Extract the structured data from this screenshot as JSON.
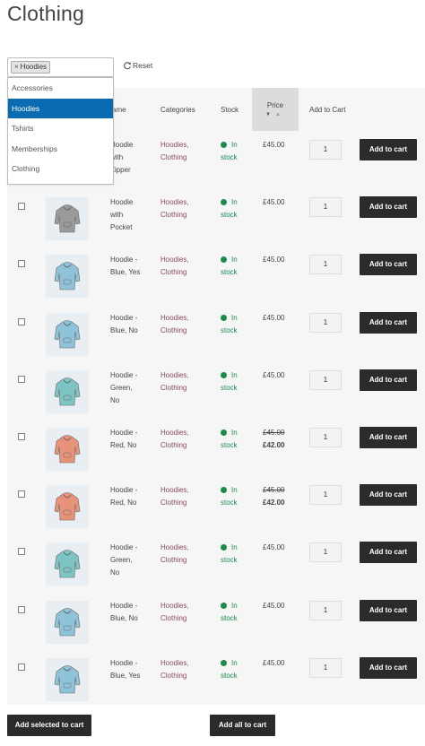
{
  "page": {
    "title": "Clothing"
  },
  "filter": {
    "chip_remove": "×",
    "chip_label": "Hoodies",
    "reset_label": "Reset"
  },
  "dropdown": {
    "options": [
      "Accessories",
      "Hoodies",
      "Tshirts",
      "Memberships",
      "Clothing"
    ],
    "selected": "Hoodies"
  },
  "table": {
    "headers": {
      "name": "ame",
      "categories": "Categories",
      "stock": "Stock",
      "price": "Price",
      "add_to_cart": "Add to Cart"
    },
    "rows": [
      {
        "name": "Hoodie with Zipper",
        "name_lines": [
          "Hoodie",
          "with",
          "Zipper"
        ],
        "categories": [
          "Hoodies,",
          "Clothing"
        ],
        "stock": [
          "In",
          "stock"
        ],
        "price": "£45.00",
        "sale_price": "",
        "qty": "1",
        "button": "Add to cart",
        "thumb_color": "none"
      },
      {
        "name": "Hoodie with Pocket",
        "name_lines": [
          "Hoodie",
          "with",
          "Pocket"
        ],
        "categories": [
          "Hoodies,",
          "Clothing"
        ],
        "stock": [
          "In",
          "stock"
        ],
        "price": "£45.00",
        "sale_price": "",
        "qty": "1",
        "button": "Add to cart",
        "thumb_color": "#9a9a9a"
      },
      {
        "name": "Hoodie - Blue, Yes",
        "name_lines": [
          "Hoodie -",
          "Blue, Yes"
        ],
        "categories": [
          "Hoodies,",
          "Clothing"
        ],
        "stock": [
          "In",
          "stock"
        ],
        "price": "£45.00",
        "sale_price": "",
        "qty": "1",
        "button": "Add to cart",
        "thumb_color": "#8fc3da"
      },
      {
        "name": "Hoodie - Blue, No",
        "name_lines": [
          "Hoodie -",
          "Blue, No"
        ],
        "categories": [
          "Hoodies,",
          "Clothing"
        ],
        "stock": [
          "In",
          "stock"
        ],
        "price": "£45.00",
        "sale_price": "",
        "qty": "1",
        "button": "Add to cart",
        "thumb_color": "#8fc3da"
      },
      {
        "name": "Hoodie - Green, No",
        "name_lines": [
          "Hoodie -",
          "Green,",
          "No"
        ],
        "categories": [
          "Hoodies,",
          "Clothing"
        ],
        "stock": [
          "In",
          "stock"
        ],
        "price": "£45.00",
        "sale_price": "",
        "qty": "1",
        "button": "Add to cart",
        "thumb_color": "#7fc4c4"
      },
      {
        "name": "Hoodie - Red, No",
        "name_lines": [
          "Hoodie -",
          "Red, No"
        ],
        "categories": [
          "Hoodies,",
          "Clothing"
        ],
        "stock": [
          "In",
          "stock"
        ],
        "price": "£45.00",
        "sale_price": "£42.00",
        "qty": "1",
        "button": "Add to cart",
        "thumb_color": "#e8927a"
      },
      {
        "name": "Hoodie - Red, No",
        "name_lines": [
          "Hoodie -",
          "Red, No"
        ],
        "categories": [
          "Hoodies,",
          "Clothing"
        ],
        "stock": [
          "In",
          "stock"
        ],
        "price": "£45.00",
        "sale_price": "£42.00",
        "qty": "1",
        "button": "Add to cart",
        "thumb_color": "#e8927a"
      },
      {
        "name": "Hoodie - Green, No",
        "name_lines": [
          "Hoodie -",
          "Green,",
          "No"
        ],
        "categories": [
          "Hoodies,",
          "Clothing"
        ],
        "stock": [
          "In",
          "stock"
        ],
        "price": "£45.00",
        "sale_price": "",
        "qty": "1",
        "button": "Add to cart",
        "thumb_color": "#7fc4c4"
      },
      {
        "name": "Hoodie - Blue, No",
        "name_lines": [
          "Hoodie -",
          "Blue, No"
        ],
        "categories": [
          "Hoodies,",
          "Clothing"
        ],
        "stock": [
          "In",
          "stock"
        ],
        "price": "£45.00",
        "sale_price": "",
        "qty": "1",
        "button": "Add to cart",
        "thumb_color": "#8fc3da"
      },
      {
        "name": "Hoodie - Blue, Yes",
        "name_lines": [
          "Hoodie -",
          "Blue, Yes"
        ],
        "categories": [
          "Hoodies,",
          "Clothing"
        ],
        "stock": [
          "In",
          "stock"
        ],
        "price": "£45.00",
        "sale_price": "",
        "qty": "1",
        "button": "Add to cart",
        "thumb_color": "#8fc3da"
      }
    ]
  },
  "footer": {
    "add_selected": "Add selected to cart",
    "add_all": "Add all to cart"
  },
  "colors": {
    "accent": "#0a6bb0",
    "button": "#2b2b2b",
    "stock": "#1e8a4c",
    "category_link": "#8a4a5a"
  },
  "icons": {
    "reset": "refresh-icon",
    "stock": "in-stock-dot-icon",
    "sort": "sort-arrows-icon"
  }
}
